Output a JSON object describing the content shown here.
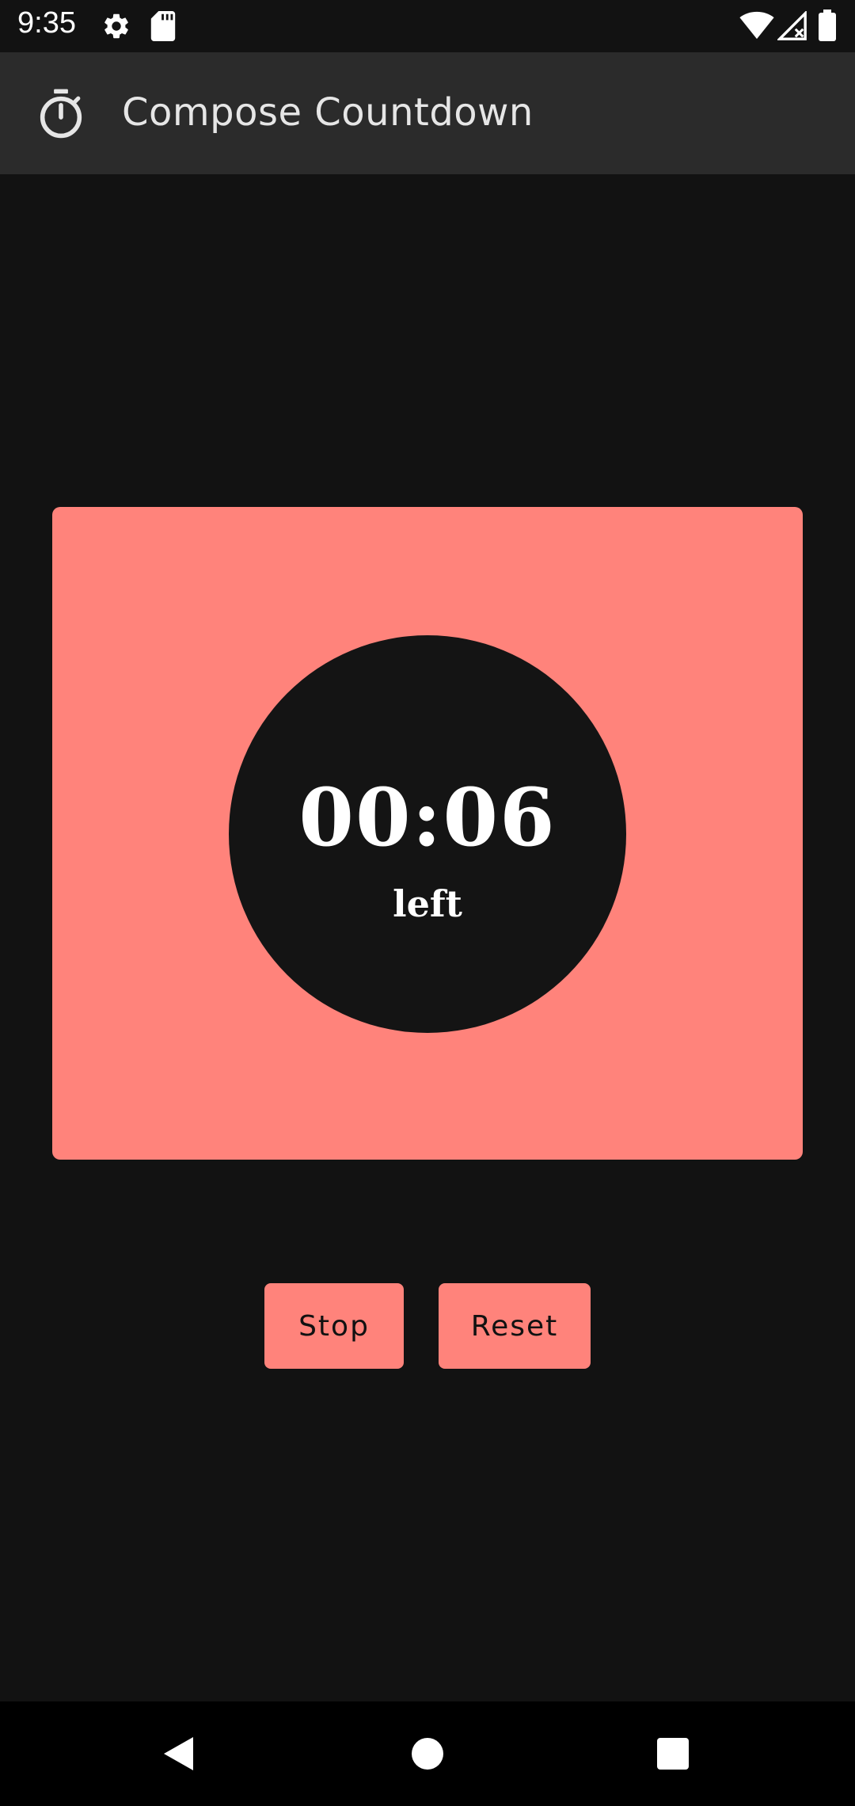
{
  "status_bar": {
    "time": "9:35",
    "icons_left": [
      "settings-icon",
      "sd-card-icon"
    ],
    "icons_right": [
      "wifi-icon",
      "signal-icon",
      "battery-icon"
    ]
  },
  "app_bar": {
    "icon": "timer-icon",
    "title": "Compose Countdown"
  },
  "timer": {
    "value": "00:06",
    "caption": "left",
    "card_color": "#ff837b",
    "circle_color": "#141414"
  },
  "actions": {
    "stop_label": "Stop",
    "reset_label": "Reset"
  },
  "navigation": {
    "back_icon": "back-icon",
    "home_icon": "home-icon",
    "recents_icon": "recents-icon"
  },
  "colors": {
    "background": "#121212",
    "app_bar": "#2b2b2b",
    "accent": "#ff837b"
  }
}
